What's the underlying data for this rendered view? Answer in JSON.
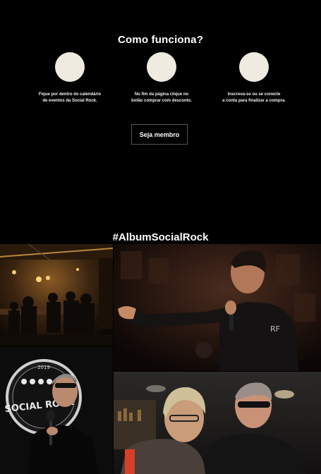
{
  "how_it_works": {
    "title": "Como funciona?",
    "steps": [
      {
        "line1": "Fique por dentro do calendário",
        "line2": "de eventos da Social Rock."
      },
      {
        "line1": "No fim da página clique no",
        "line2": "botão comprar com desconto."
      },
      {
        "line1": "Inscreva-se ou se conecte",
        "line2": "a conta para finalizar a compra."
      }
    ],
    "cta_label": "Seja membro"
  },
  "album": {
    "title": "#AlbumSocialRock",
    "logo_text": "SOCIAL ROCK",
    "logo_year": "2019"
  },
  "colors": {
    "background": "#000000",
    "circle": "#efebe0",
    "text": "#ffffff"
  }
}
